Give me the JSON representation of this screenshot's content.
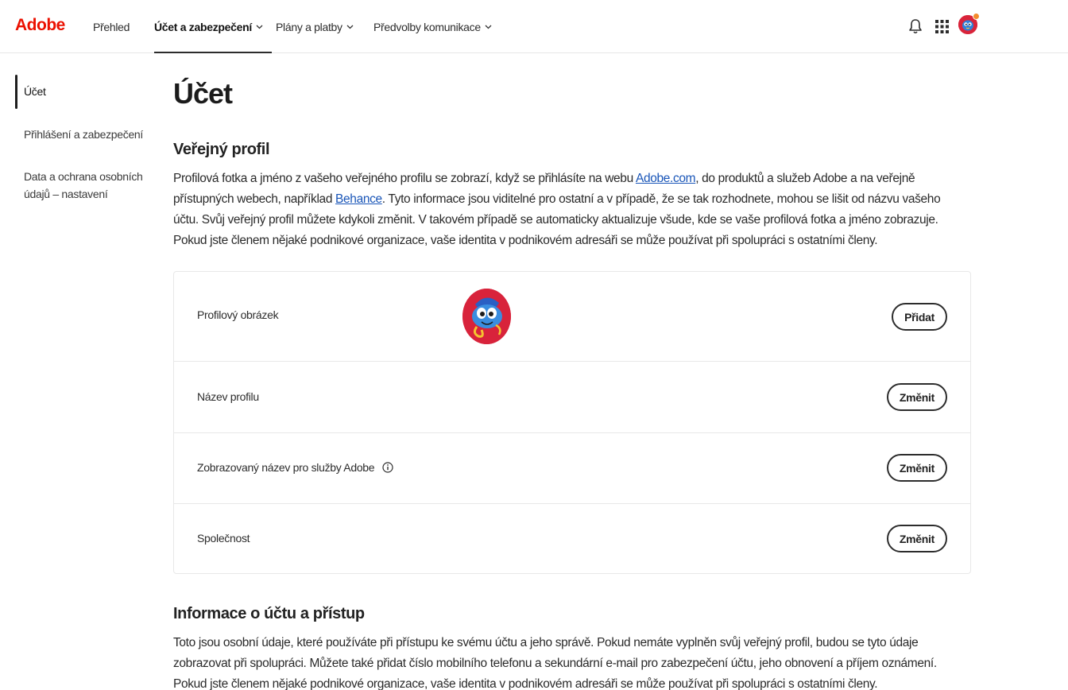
{
  "brand": {
    "logo_text": "Adobe",
    "accent_color": "#eb1000"
  },
  "topnav": {
    "items": [
      {
        "label": "Přehled",
        "has_dropdown": false,
        "active": false
      },
      {
        "label": "Účet a zabezpečení",
        "has_dropdown": true,
        "active": true
      },
      {
        "label": "Plány a platby",
        "has_dropdown": true,
        "active": false
      },
      {
        "label": "Předvolby komunikace",
        "has_dropdown": true,
        "active": false
      }
    ],
    "icons": [
      "bell-icon",
      "apps-grid-icon",
      "user-avatar"
    ]
  },
  "sidebar": {
    "items": [
      {
        "label": "Účet",
        "active": true
      },
      {
        "label": "Přihlášení a zabezpečení",
        "active": false
      },
      {
        "label": "Data a ochrana osobních údajů – nastavení",
        "active": false
      }
    ]
  },
  "main": {
    "title": "Účet",
    "public_profile": {
      "heading": "Veřejný profil",
      "para_part1": "Profilová fotka a jméno z vašeho veřejného profilu se zobrazí, když se přihlásíte na webu ",
      "link1": "Adobe.com",
      "para_part2": ", do produktů a služeb Adobe a na veřejně přístupných webech, například ",
      "link2": "Behance",
      "para_part3": ". Tyto informace jsou viditelné pro ostatní a v případě, že se tak rozhodnete, mohou se lišit od názvu vašeho účtu. Svůj veřejný profil můžete kdykoli změnit. V takovém případě se automaticky aktualizuje všude, kde se vaše profilová fotka a jméno zobrazuje. Pokud jste členem nějaké podnikové organizace, vaše identita v podnikovém adresáři se může používat při spolupráci s ostatními členy.",
      "rows": [
        {
          "label": "Profilový obrázek",
          "button": "Přidat"
        },
        {
          "label": "Název profilu",
          "button": "Změnit"
        },
        {
          "label": "Zobrazovaný název pro služby Adobe",
          "button": "Změnit"
        },
        {
          "label": "Společnost",
          "button": "Změnit"
        }
      ]
    },
    "account_info": {
      "heading": "Informace o účtu a přístup",
      "para": "Toto jsou osobní údaje, které používáte při přístupu ke svému účtu a jeho správě. Pokud nemáte vyplněn svůj veřejný profil, budou se tyto údaje zobrazovat při spolupráci. Můžete také přidat číslo mobilního telefonu a sekundární e-mail pro zabezpečení účtu, jeho obnovení a příjem oznámení. Pokud jste členem nějaké podnikové organizace, vaše identita v podnikovém adresáři se může používat při spolupráci s ostatními členy."
    }
  }
}
